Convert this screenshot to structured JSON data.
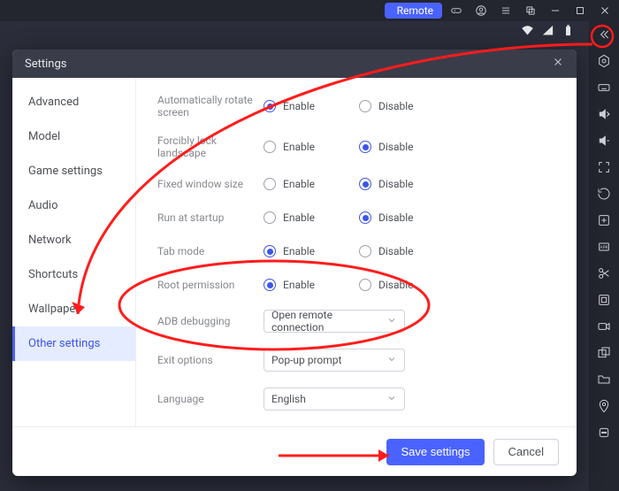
{
  "titlebar": {
    "remote_label": "Remote"
  },
  "dialog": {
    "title": "Settings",
    "nav": [
      "Advanced",
      "Model",
      "Game settings",
      "Audio",
      "Network",
      "Shortcuts",
      "Wallpaper",
      "Other settings"
    ],
    "active_nav_index": 7,
    "rows": [
      {
        "label": "Automatically rotate screen",
        "type": "radio",
        "options": [
          "Enable",
          "Disable"
        ],
        "selected": 0
      },
      {
        "label": "Forcibly lock landscape",
        "type": "radio",
        "options": [
          "Enable",
          "Disable"
        ],
        "selected": 1
      },
      {
        "label": "Fixed window size",
        "type": "radio",
        "options": [
          "Enable",
          "Disable"
        ],
        "selected": 1
      },
      {
        "label": "Run at startup",
        "type": "radio",
        "options": [
          "Enable",
          "Disable"
        ],
        "selected": 1
      },
      {
        "label": "Tab mode",
        "type": "radio",
        "options": [
          "Enable",
          "Disable"
        ],
        "selected": 0
      },
      {
        "label": "Root permission",
        "type": "radio",
        "options": [
          "Enable",
          "Disable"
        ],
        "selected": 0
      },
      {
        "label": "ADB debugging",
        "type": "select",
        "value": "Open remote connection"
      },
      {
        "label": "Exit options",
        "type": "select",
        "value": "Pop-up prompt"
      },
      {
        "label": "Language",
        "type": "select",
        "value": "English"
      }
    ],
    "footer": {
      "save_label": "Save settings",
      "cancel_label": "Cancel"
    }
  }
}
